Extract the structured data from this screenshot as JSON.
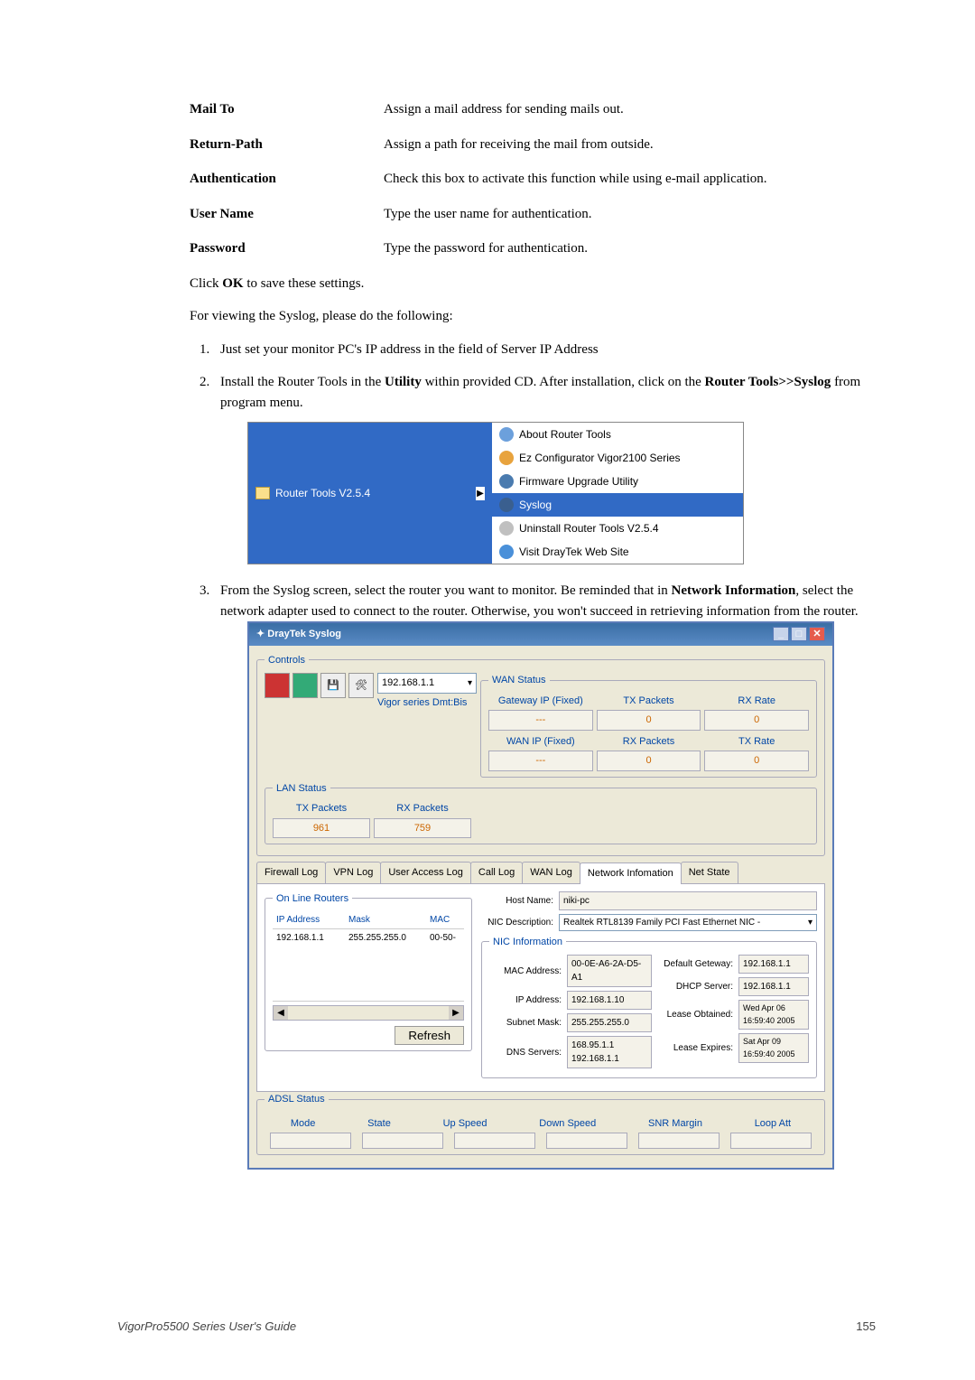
{
  "defs": {
    "mailto": {
      "term": "Mail To",
      "desc": "Assign a mail address for sending mails out."
    },
    "returnpath": {
      "term": "Return-Path",
      "desc": "Assign a path for receiving the mail from outside."
    },
    "auth": {
      "term": "Authentication",
      "desc": "Check this box to activate this function while using e-mail application."
    },
    "username": {
      "term": "User Name",
      "desc": "Type the user name for authentication."
    },
    "password": {
      "term": "Password",
      "desc": "Type the password for authentication."
    }
  },
  "click_ok": "Click OK to save these settings.",
  "viewing_intro": "For viewing the Syslog, please do the following:",
  "steps": {
    "s1": "Just set your monitor PC's IP address in the field of Server IP Address",
    "s2_pre": "Install the Router Tools in the ",
    "s2_bold1": "Utility",
    "s2_mid": " within provided CD. After installation, click on the ",
    "s2_bold2": "Router Tools>>Syslog",
    "s2_post": " from program menu.",
    "s3_pre": "From the Syslog screen, select the router you want to monitor. Be reminded that in ",
    "s3_bold": "Network Information",
    "s3_post": ", select the network adapter used to connect to the router. Otherwise, you won't succeed in retrieving information from the router."
  },
  "menu": {
    "parent": "Router Tools V2.5.4",
    "items": {
      "about": "About Router Tools",
      "ez": "Ez Configurator Vigor2100 Series",
      "fw": "Firmware Upgrade Utility",
      "syslog": "Syslog",
      "uninstall": "Uninstall Router Tools V2.5.4",
      "visit": "Visit DrayTek Web Site"
    }
  },
  "syslog": {
    "title": "DrayTek Syslog",
    "controls_legend": "Controls",
    "ip": "192.168.1.1",
    "series": "Vigor series Dmt:Bis",
    "lan_legend": "LAN Status",
    "wan_legend": "WAN Status",
    "txpackets_label": "TX Packets",
    "rxpackets_label": "RX Packets",
    "txrate_label": "TX Rate",
    "rxrate_label": "RX Rate",
    "gateway_label": "Gateway IP (Fixed)",
    "wanip_label": "WAN IP (Fixed)",
    "lan_tx": "961",
    "lan_rx": "759",
    "dashes": "---",
    "zero": "0",
    "tabs": {
      "firewall": "Firewall Log",
      "vpn": "VPN Log",
      "user": "User Access Log",
      "call": "Call Log",
      "wan": "WAN Log",
      "netinfo": "Network Infomation",
      "netstate": "Net State"
    },
    "routers_legend": "On Line Routers",
    "routers_cols": {
      "ip": "IP Address",
      "mask": "Mask",
      "mac": "MAC"
    },
    "routers_row": {
      "ip": "192.168.1.1",
      "mask": "255.255.255.0",
      "mac": "00-50-"
    },
    "refresh": "Refresh",
    "hostname_label": "Host Name:",
    "hostname": "niki-pc",
    "nicdesc_label": "NIC Description:",
    "nicdesc": "Realtek RTL8139 Family PCI Fast Ethernet NIC - ",
    "nicinfo_legend": "NIC Information",
    "nic": {
      "mac_label": "MAC Address:",
      "mac": "00-0E-A6-2A-D5-A1",
      "ip_label": "IP Address:",
      "ip": "192.168.1.10",
      "subnet_label": "Subnet Mask:",
      "subnet": "255.255.255.0",
      "dns_label": "DNS Servers:",
      "dns": "168.95.1.1\n192.168.1.1",
      "gw_label": "Default Geteway:",
      "gw": "192.168.1.1",
      "dhcp_label": "DHCP Server:",
      "dhcp": "192.168.1.1",
      "obtained_label": "Lease Obtained:",
      "obtained": "Wed Apr 06 16:59:40 2005",
      "expires_label": "Lease Expires:",
      "expires": "Sat Apr 09 16:59:40 2005"
    },
    "adsl_legend": "ADSL Status",
    "adsl_cols": {
      "mode": "Mode",
      "state": "State",
      "up": "Up Speed",
      "down": "Down Speed",
      "snr": "SNR Margin",
      "loop": "Loop Att"
    }
  },
  "footer": {
    "guide": "VigorPro5500 Series User's Guide",
    "page": "155"
  }
}
